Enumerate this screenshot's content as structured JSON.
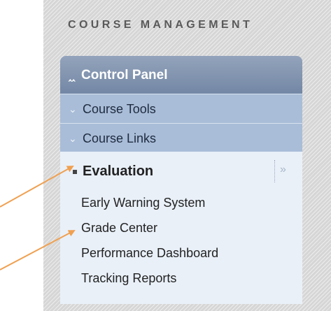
{
  "section_title": "COURSE MANAGEMENT",
  "control_panel": {
    "label": "Control Panel"
  },
  "menu_items": [
    {
      "label": "Course Tools"
    },
    {
      "label": "Course Links"
    }
  ],
  "evaluation": {
    "label": "Evaluation",
    "sub_items": [
      {
        "label": "Early Warning System"
      },
      {
        "label": "Grade Center"
      },
      {
        "label": "Performance Dashboard"
      },
      {
        "label": "Tracking Reports"
      }
    ]
  },
  "icons": {
    "control_panel": "double-chevron-up-icon",
    "collapsed_item": "double-chevron-down-icon",
    "expand": "double-chevron-right-icon"
  },
  "colors": {
    "header": "#7f92ae",
    "menu_row": "#a9bdd8",
    "panel": "#e9f0f8",
    "arrow": "#f0a050"
  }
}
